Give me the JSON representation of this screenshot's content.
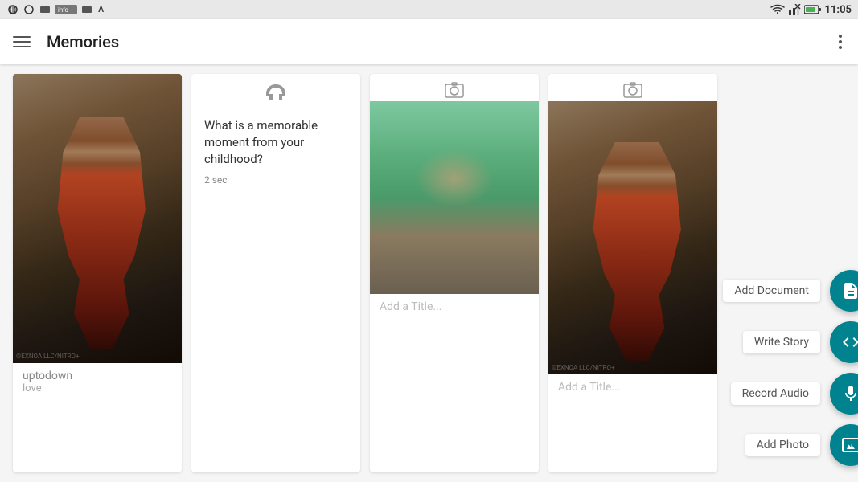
{
  "statusBar": {
    "time": "11:05",
    "icons": [
      "wifi",
      "signal",
      "battery"
    ]
  },
  "appBar": {
    "title": "Memories",
    "menuLabel": "Open navigation menu",
    "moreLabel": "More options"
  },
  "cards": [
    {
      "id": "card-1",
      "type": "image",
      "typeIcon": "photo",
      "title": "uptodown",
      "subtitle": "love",
      "watermark": "©EXNOA LLC/NITRO+"
    },
    {
      "id": "card-2",
      "type": "audio",
      "typeIcon": "headphones",
      "question": "What is a memorable moment from your childhood?",
      "duration": "2 sec"
    },
    {
      "id": "card-3",
      "type": "image",
      "typeIcon": "photo",
      "addTitlePlaceholder": "Add a Title..."
    },
    {
      "id": "card-4",
      "type": "image",
      "typeIcon": "photo",
      "addTitlePlaceholder": "Add a Title...",
      "watermark": "©EXNOA LLC/NITRO+"
    }
  ],
  "fabButtons": [
    {
      "id": "add-document",
      "label": "Add Document",
      "icon": "document"
    },
    {
      "id": "write-story",
      "label": "Write Story",
      "icon": "text"
    },
    {
      "id": "record-audio",
      "label": "Record Audio",
      "icon": "mic"
    },
    {
      "id": "add-photo",
      "label": "Add Photo",
      "icon": "image"
    }
  ]
}
